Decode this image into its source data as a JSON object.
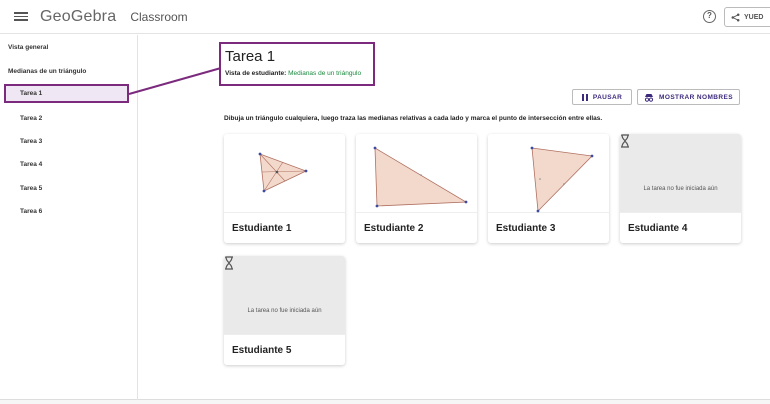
{
  "header": {
    "logo": "GeoGebra",
    "app_name": "Classroom",
    "share_label": "YUED"
  },
  "sidebar": {
    "overview": "Vista general",
    "activity": "Medianas de un triángulo",
    "tasks": [
      "Tarea 1",
      "Tarea 2",
      "Tarea 3",
      "Tarea 4",
      "Tarea 5",
      "Tarea 6"
    ]
  },
  "main": {
    "title": "Tarea 1",
    "student_view_label": "Vista de estudiante:",
    "student_view_link": "Medianas de un triángulo",
    "pause_label": "PAUSAR",
    "show_names_label": "MOSTRAR NOMBRES",
    "instructions": "Dibuja un triángulo cualquiera, luego traza las medianas relativas a cada lado y marca el punto de intersección entre ellas.",
    "students": [
      {
        "name": "Estudiante 1",
        "status": ""
      },
      {
        "name": "Estudiante 2",
        "status": ""
      },
      {
        "name": "Estudiante 3",
        "status": ""
      },
      {
        "name": "Estudiante 4",
        "status": "La tarea no fue iniciada aún"
      },
      {
        "name": "Estudiante 5",
        "status": "La tarea no fue iniciada aún"
      }
    ]
  },
  "colors": {
    "highlight": "#7b2a7e",
    "accent": "#3d2a7d",
    "link": "#1a8a3e",
    "triangle_fill": "#f3d9cc"
  }
}
